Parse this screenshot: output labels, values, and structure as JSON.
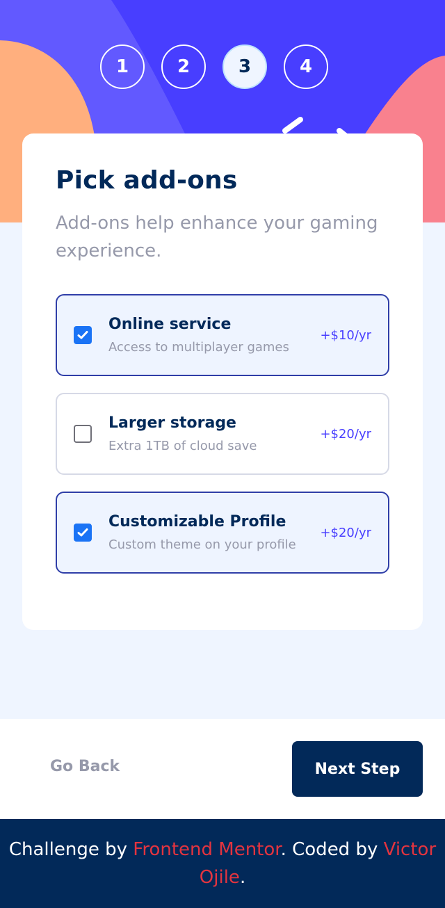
{
  "steps": [
    "1",
    "2",
    "3",
    "4"
  ],
  "active_step": 3,
  "colors": {
    "hero_base": "#483eff",
    "hero_light": "#6259ff",
    "hero_orange": "#ffaf7e",
    "hero_pink": "#f9818e",
    "primary_dark": "#022959",
    "accent": "#483eff",
    "muted": "#9699aa",
    "link_red": "#e3343f"
  },
  "card": {
    "title": "Pick add-ons",
    "subtitle": "Add-ons help enhance your gaming experience."
  },
  "addons": [
    {
      "name": "Online service",
      "desc": "Access to multiplayer games",
      "price": "+$10/yr",
      "selected": true
    },
    {
      "name": "Larger storage",
      "desc": "Extra 1TB of cloud save",
      "price": "+$20/yr",
      "selected": false
    },
    {
      "name": "Customizable Profile",
      "desc": "Custom theme on your profile",
      "price": "+$20/yr",
      "selected": true
    }
  ],
  "nav": {
    "back_label": "Go Back",
    "next_label": "Next Step"
  },
  "attribution": {
    "prefix": "Challenge by ",
    "link1": "Frontend Mentor",
    "middle": ". Coded by ",
    "link2": "Victor Ojile",
    "suffix": "."
  }
}
